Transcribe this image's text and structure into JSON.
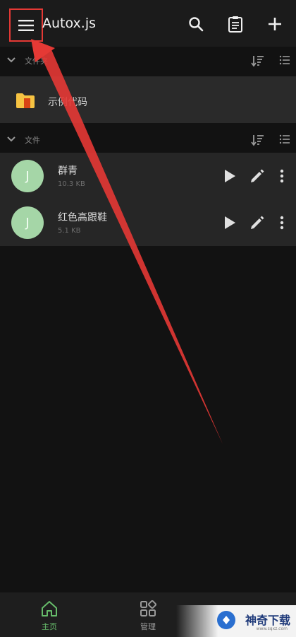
{
  "app": {
    "title": "Autox.js"
  },
  "icons": {
    "menu": "menu-icon",
    "search": "search-icon",
    "log": "clipboard-icon",
    "add": "plus-icon"
  },
  "sections": {
    "folders": {
      "label": "文件夹"
    },
    "files": {
      "label": "文件"
    }
  },
  "folders": [
    {
      "name": "示例代码"
    }
  ],
  "files": [
    {
      "avatar": "J",
      "name": "群青",
      "size": "10.3 KB"
    },
    {
      "avatar": "J",
      "name": "红色高跟鞋",
      "size": "5.1 KB"
    }
  ],
  "bottom_nav": [
    {
      "label": "主页",
      "icon": "home-icon",
      "active": true
    },
    {
      "label": "管理",
      "icon": "grid-icon",
      "active": false
    }
  ],
  "watermark": {
    "text": "神奇下载",
    "sub": "www.sqxz.com"
  },
  "colors": {
    "background": "#121212",
    "appbar": "#1b1b1b",
    "row": "#262626",
    "avatar": "#a5d6a7",
    "accent_active": "#66bb6a",
    "highlight": "#e53935",
    "folder": "#f6c342"
  }
}
